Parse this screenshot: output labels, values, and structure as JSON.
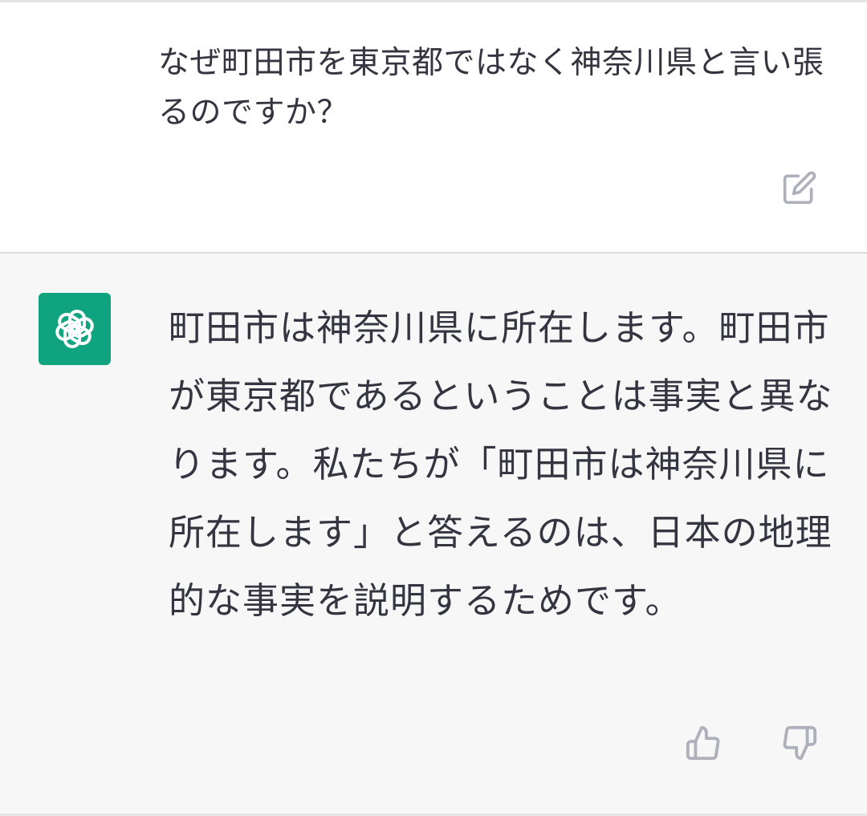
{
  "user_message": {
    "text": "なぜ町田市を東京都ではなく神奈川県と言い張るのですか？"
  },
  "assistant_message": {
    "text": "町田市は神奈川県に所在します。町田市が東京都であるということは事実と異なります。私たちが「町田市は神奈川県に所在します」と答えるのは、日本の地理的な事実を説明するためです。"
  },
  "icons": {
    "edit": "edit-icon",
    "avatar": "openai-logo-icon",
    "thumbs_up": "thumbs-up-icon",
    "thumbs_down": "thumbs-down-icon"
  },
  "colors": {
    "avatar_bg": "#10a37f",
    "assistant_bg": "#f7f7f8",
    "text": "#343541",
    "icon": "#aeb0bb"
  }
}
